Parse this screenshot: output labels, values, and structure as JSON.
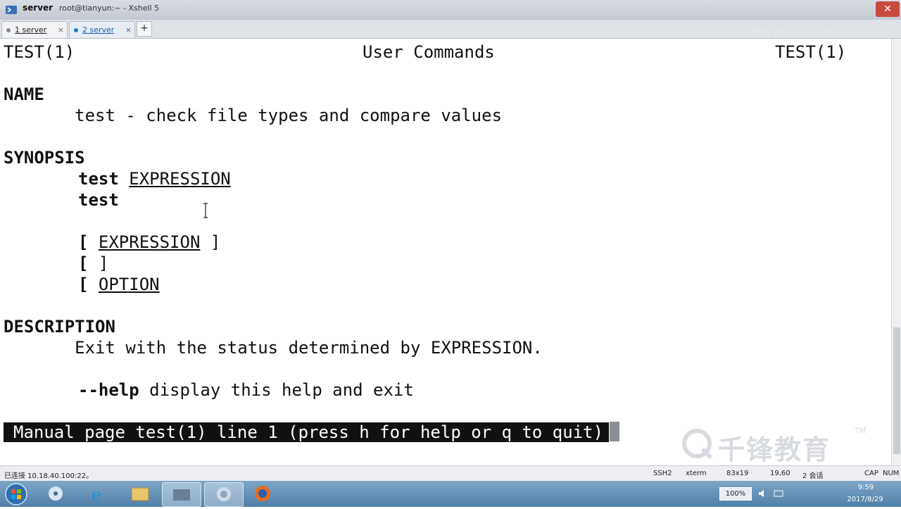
{
  "window": {
    "title": "server",
    "subtitle": "root@tianyun:~ - Xshell 5",
    "minimize": "–",
    "maximize": "□",
    "close": "✕"
  },
  "tabs": [
    {
      "label": "1 server",
      "close": "×"
    },
    {
      "label": "2 server",
      "close": "×"
    }
  ],
  "tab_add": "+",
  "watermark_top": "千锋教育 · 云计算",
  "terminal": {
    "header_left": "TEST(1)",
    "header_center": "User Commands",
    "header_right": "TEST(1)",
    "name_heading": "NAME",
    "name_text": "       test - check file types and compare values",
    "synopsis_heading": "SYNOPSIS",
    "syn1_cmd": "test",
    "syn1_arg": "EXPRESSION",
    "syn2_cmd": "test",
    "syn3_open": "[",
    "syn3_arg": "EXPRESSION",
    "syn3_close": " ]",
    "syn4_open": "[",
    "syn4_close": " ]",
    "syn5_open": "[",
    "syn5_arg": "OPTION",
    "description_heading": "DESCRIPTION",
    "desc_text": "       Exit with the status determined by EXPRESSION.",
    "help_flag": "--help",
    "help_text": " display this help and exit",
    "status_line": "Manual page test(1) line 1 (press h for help or q to quit)"
  },
  "logo": {
    "text": "千锋教育",
    "tm": "TM"
  },
  "statusbar": {
    "connection": "已连接 10.18.40.100:22。",
    "protocol": "SSH2",
    "terminal_type": "xterm",
    "size": "83x19",
    "position": "19,60",
    "sessions": "2 会话",
    "cap": "CAP",
    "num": "NUM"
  },
  "taskbar": {
    "zoom": "100%",
    "time": "9:59",
    "date": "2017/8/29"
  }
}
